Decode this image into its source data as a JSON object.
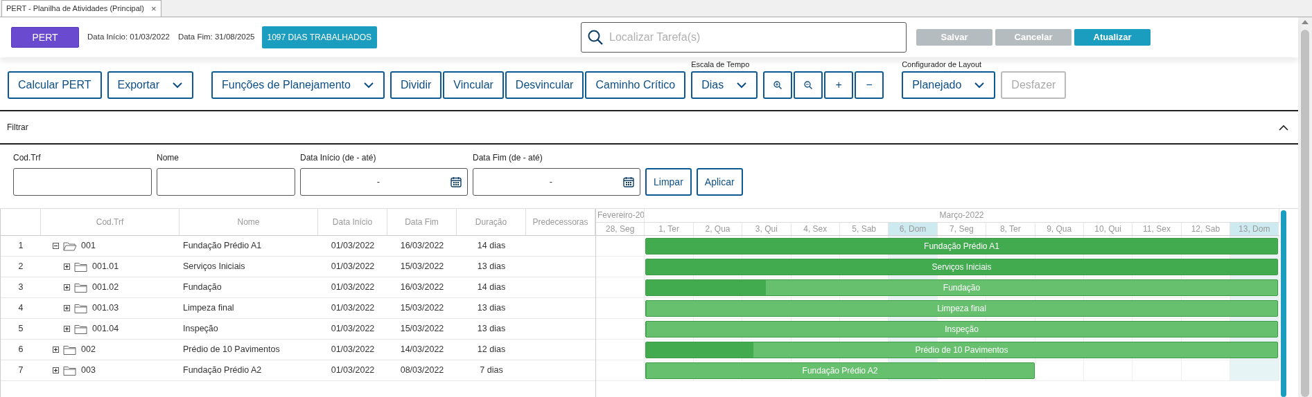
{
  "window": {
    "tab": {
      "title": "PERT - Planilha de Atividades (Principal)",
      "close": "×"
    }
  },
  "header": {
    "pert_button": "PERT",
    "start_label": "Data Início:",
    "start_value": "01/03/2022",
    "end_label": "Data Fim:",
    "end_value": "31/08/2025",
    "badge": "1097 DIAS TRABALHADOS",
    "search": {
      "placeholder": "Localizar Tarefa(s)"
    },
    "buttons": [
      {
        "label": "Salvar",
        "disabled": true
      },
      {
        "label": "Cancelar",
        "disabled": true
      },
      {
        "label": "Atualizar",
        "disabled": false
      }
    ]
  },
  "toolbar": [
    {
      "buttons": [
        {
          "label": "Calcular PERT",
          "kind": "button",
          "disabled": false
        }
      ]
    },
    {
      "buttons": [
        {
          "label": "Exportar",
          "kind": "dropdown",
          "disabled": false
        }
      ]
    },
    {
      "buttons": [
        {
          "label": "Funções de Planejamento",
          "kind": "dropdown",
          "disabled": false
        }
      ]
    },
    {
      "buttons": [
        {
          "label": "Dividir",
          "kind": "button",
          "disabled": false
        },
        {
          "label": "Vincular",
          "kind": "button",
          "disabled": false
        },
        {
          "label": "Desvincular",
          "kind": "button",
          "disabled": false
        },
        {
          "label": "Caminho Crítico",
          "kind": "button",
          "disabled": false
        }
      ]
    },
    {
      "caption": "Escala de Tempo",
      "buttons": [
        {
          "label": "Dias",
          "kind": "dropdown",
          "disabled": false
        }
      ]
    },
    {
      "buttons": [
        {
          "kind": "zoom-in",
          "disabled": false
        },
        {
          "kind": "zoom-out",
          "disabled": false
        },
        {
          "label": "+",
          "kind": "button",
          "disabled": false
        },
        {
          "label": "−",
          "kind": "button",
          "disabled": false
        }
      ]
    },
    {
      "caption": "Configurador de Layout",
      "buttons": [
        {
          "label": "Planejado",
          "kind": "dropdown",
          "disabled": false
        }
      ]
    },
    {
      "buttons": [
        {
          "label": "Desfazer",
          "kind": "button",
          "disabled": true
        }
      ]
    }
  ],
  "filter": {
    "title": "Filtrar",
    "expanded": true,
    "fields": [
      {
        "label": "Cod.Trf",
        "kind": "text"
      },
      {
        "label": "Nome",
        "kind": "text"
      },
      {
        "label": "Data Início (de - até)",
        "kind": "daterange",
        "value": "-"
      },
      {
        "label": "Data Fim (de - até)",
        "kind": "daterange",
        "value": "-"
      }
    ],
    "buttons": [
      "Limpar",
      "Aplicar"
    ]
  },
  "table": {
    "columns": [
      "Cod.Trf",
      "Nome",
      "Data Início",
      "Data Fim",
      "Duração",
      "Predecessoras"
    ],
    "rows": [
      {
        "number": "1",
        "code": "001",
        "name": "Fundação Prédio A1",
        "start": "01/03/2022",
        "end": "16/03/2022",
        "duration": "14 dias",
        "expanded": true,
        "bar": {
          "label": "Fundação Prédio A1",
          "level": 1
        },
        "children": [
          {
            "number": "2",
            "code": "001.01",
            "name": "Serviços Iniciais",
            "start": "01/03/2022",
            "end": "15/03/2022",
            "duration": "13 dias",
            "expanded": false,
            "bar": {
              "label": "Serviços Iniciais",
              "level": 1
            }
          },
          {
            "number": "3",
            "code": "001.02",
            "name": "Fundação",
            "start": "01/03/2022",
            "end": "16/03/2022",
            "duration": "14 dias",
            "expanded": false,
            "bar": {
              "label": "Fundação",
              "level": 0.19
            }
          },
          {
            "number": "4",
            "code": "001.03",
            "name": "Limpeza final",
            "start": "01/03/2022",
            "end": "15/03/2022",
            "duration": "13 dias",
            "expanded": false,
            "bar": {
              "label": "Limpeza final",
              "level": 0
            }
          },
          {
            "number": "5",
            "code": "001.04",
            "name": "Inspeção",
            "start": "01/03/2022",
            "end": "15/03/2022",
            "duration": "13 dias",
            "expanded": false,
            "bar": {
              "label": "Inspeção",
              "level": 0
            }
          }
        ]
      },
      {
        "number": "6",
        "code": "002",
        "name": "Prédio de 10 Pavimentos",
        "start": "01/03/2022",
        "end": "14/03/2022",
        "duration": "12 dias",
        "expanded": false,
        "bar": {
          "label": "Prédio de 10 Pavimentos",
          "level": 0.17
        }
      },
      {
        "number": "7",
        "code": "003",
        "name": "Fundação Prédio A2",
        "start": "01/03/2022",
        "end": "08/03/2022",
        "duration": "7 dias",
        "expanded": false,
        "bar": {
          "label": "Fundação Prédio A2",
          "level": 0
        }
      }
    ]
  },
  "gantt": {
    "months": [
      {
        "label": "Fevereiro-20",
        "days": [
          {
            "label": "28, Seg",
            "highlight": false
          }
        ]
      },
      {
        "label": "Março-2022",
        "days": [
          {
            "label": "1, Ter",
            "highlight": false
          },
          {
            "label": "2, Qua",
            "highlight": false
          },
          {
            "label": "3, Qui",
            "highlight": false
          },
          {
            "label": "4, Sex",
            "highlight": false
          },
          {
            "label": "5, Sab",
            "highlight": false
          },
          {
            "label": "6, Dom",
            "highlight": true
          },
          {
            "label": "7, Seg",
            "highlight": false
          },
          {
            "label": "8, Ter",
            "highlight": false
          },
          {
            "label": "9, Qua",
            "highlight": false
          },
          {
            "label": "10, Qui",
            "highlight": false
          },
          {
            "label": "11, Sex",
            "highlight": false
          },
          {
            "label": "12, Sab",
            "highlight": false
          },
          {
            "label": "13, Dom",
            "highlight": true
          }
        ]
      }
    ]
  }
}
